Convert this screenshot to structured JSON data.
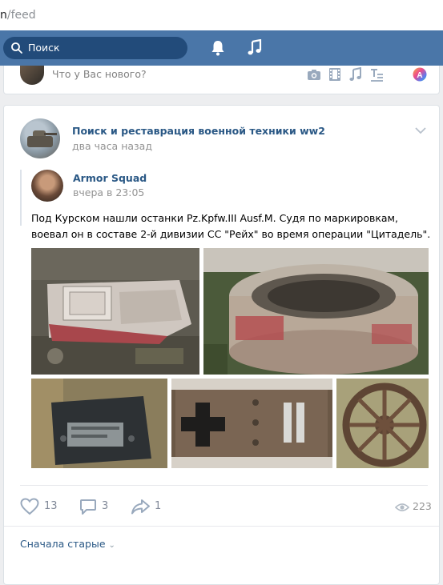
{
  "browser": {
    "url_host_fragment": "n",
    "url_path": "/feed"
  },
  "header": {
    "search_placeholder": "Поиск",
    "icons": [
      "search-icon",
      "bell-icon",
      "music-note-icon"
    ]
  },
  "composer": {
    "placeholder": "Что у Вас нового?",
    "icons": [
      "camera-icon",
      "video-film-icon",
      "music-icon",
      "text-format-icon",
      "poster-icon"
    ]
  },
  "post": {
    "group_name": "Поиск и реставрация военной техники ww2",
    "time": "два часа назад",
    "repost": {
      "author": "Armor Squad",
      "time": "вчера в 23:05",
      "text": "Под Курском нашли останки Pz.Kpfw.III Ausf.M. Судя по маркировкам, воевал он в составе 2-й дивизии СС \"Рейх\" во время операции \"Цитадель\"."
    },
    "photos": [
      "photo-1",
      "photo-2",
      "photo-3",
      "photo-4",
      "photo-5"
    ],
    "actions": {
      "likes": "13",
      "comments": "3",
      "shares": "1",
      "views": "223"
    },
    "sort_label": "Сначала старые"
  },
  "colors": {
    "header_bg": "#4a76a8",
    "search_bg": "#224b7a",
    "link": "#2a5885",
    "muted": "#939393",
    "page_bg": "#edeef0"
  }
}
